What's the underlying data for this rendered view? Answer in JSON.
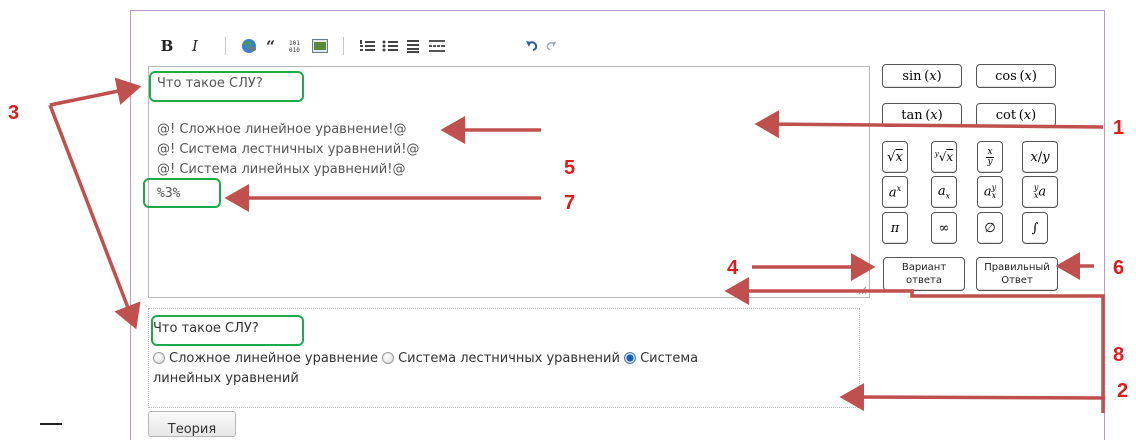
{
  "toolbar": {
    "bold": "B",
    "italic": "I",
    "icons": [
      "link-icon",
      "quote-icon",
      "code-icon",
      "image-icon",
      "numbered-list-icon",
      "bulleted-list-icon",
      "heading-icon",
      "horizontal-rule-icon",
      "undo-icon",
      "redo-icon"
    ]
  },
  "editor": {
    "question": "Что такое СЛУ?",
    "options": [
      "@! Сложное линейное уравнение!@",
      "@! Система лестничных уравнений!@",
      "@! Система линейных уравнений!@"
    ],
    "answer_code": "%3%"
  },
  "math_buttons": {
    "sin": "sin(x)",
    "cos": "cos(x)",
    "tan": "tan(x)",
    "cot": "cot(x)",
    "sqrt": "√x",
    "root": "y√x",
    "frac": "x/y (stacked)",
    "div": "x/y",
    "pow": "aˣ",
    "sub": "aₓ",
    "subsup": "aₓʸ",
    "presubsup": "ₓʸa",
    "pi": "π",
    "infinity": "∞",
    "empty": "∅",
    "integral": "∫"
  },
  "answer_buttons": {
    "variant_line1": "Вариант",
    "variant_line2": "ответа",
    "correct_line1": "Правильный",
    "correct_line2": "Ответ"
  },
  "preview": {
    "question": "Что такое СЛУ?",
    "option1": "Сложное линейное уравнение",
    "option2": "Система лестничных уравнений",
    "option3_part1": "Система",
    "option3_part2": "линейных уравнений",
    "selected": 3
  },
  "theory_button": "Теория",
  "annotations": [
    "1",
    "2",
    "3",
    "4",
    "5",
    "6",
    "7",
    "8"
  ],
  "colors": {
    "annotation_red": "#e01b1b",
    "arrow_red": "#c0504d",
    "highlight_green": "#1faa4a",
    "frame_purple": "#b79ac9"
  }
}
